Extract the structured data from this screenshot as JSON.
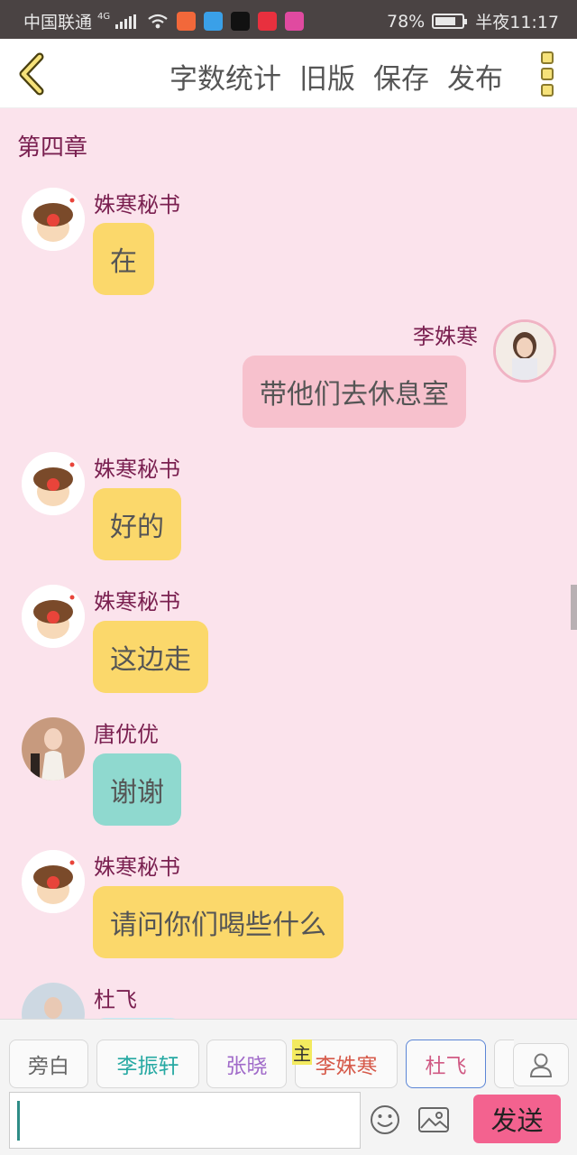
{
  "status_bar": {
    "carrier": "中国联通",
    "network": "4G",
    "battery_percent": "78%",
    "battery_level": 0.78,
    "time": "半夜11:17",
    "app_icons": [
      "app-icon-1",
      "app-icon-2",
      "tiktok-icon",
      "xiaohongshu-icon",
      "app-icon-5"
    ]
  },
  "toolbar": {
    "word_count": "字数统计",
    "old_version": "旧版",
    "save": "保存",
    "publish": "发布"
  },
  "chat": {
    "chapter_title": "第四章",
    "messages": [
      {
        "sender": "姝寒秘书",
        "text": "在",
        "side": "left",
        "color": "yellow"
      },
      {
        "sender": "李姝寒",
        "text": "带他们去休息室",
        "side": "right",
        "color": "pink"
      },
      {
        "sender": "姝寒秘书",
        "text": "好的",
        "side": "left",
        "color": "yellow"
      },
      {
        "sender": "姝寒秘书",
        "text": "这边走",
        "side": "left",
        "color": "yellow"
      },
      {
        "sender": "唐优优",
        "text": "谢谢",
        "side": "left",
        "color": "teal"
      },
      {
        "sender": "姝寒秘书",
        "text": "请问你们喝些什么",
        "side": "left",
        "color": "yellow"
      },
      {
        "sender": "杜飞",
        "text": "",
        "side": "left",
        "color": "blue"
      }
    ]
  },
  "roles": [
    {
      "name": "旁白",
      "color": "#666666",
      "selected": false
    },
    {
      "name": "李振轩",
      "color": "#27a9a3",
      "selected": false
    },
    {
      "name": "张晓",
      "color": "#a06ac9",
      "selected": false
    },
    {
      "name": "李姝寒",
      "color": "#d65a4a",
      "selected": false,
      "is_main": true
    },
    {
      "name": "杜飞",
      "color": "#d05a84",
      "selected": true
    }
  ],
  "main_role_tag": "主",
  "composer": {
    "input_value": "",
    "send_label": "发送"
  },
  "colors": {
    "accent_send": "#f3628f",
    "bubble_yellow": "#fbd86b",
    "bubble_pink": "#f7c1cd",
    "bubble_teal": "#8fd9cf",
    "chat_bg": "#fbe3ec"
  }
}
